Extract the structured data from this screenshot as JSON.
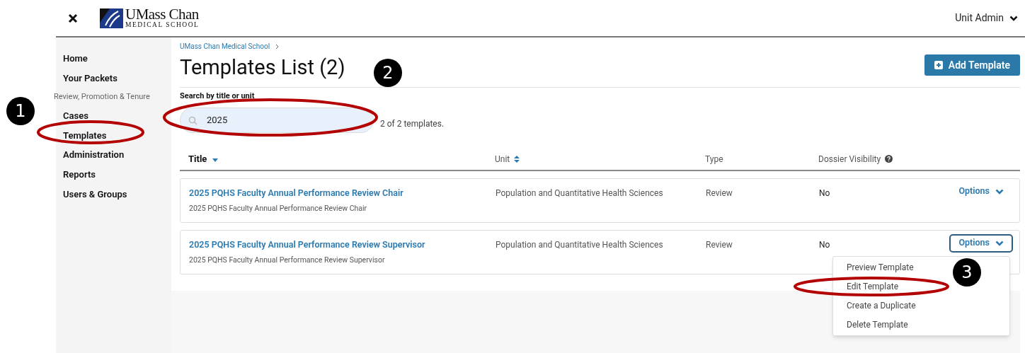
{
  "header": {
    "logo_top": "UMass Chan",
    "logo_bottom": "MEDICAL SCHOOL",
    "user_menu": "Unit Admin"
  },
  "sidebar": {
    "items": [
      {
        "label": "Home",
        "kind": "link"
      },
      {
        "label": "Your Packets",
        "kind": "link"
      },
      {
        "label": "Review, Promotion & Tenure",
        "kind": "section"
      },
      {
        "label": "Cases",
        "kind": "link"
      },
      {
        "label": "Templates",
        "kind": "link"
      },
      {
        "label": "Administration",
        "kind": "link"
      },
      {
        "label": "Reports",
        "kind": "link"
      },
      {
        "label": "Users & Groups",
        "kind": "link"
      }
    ]
  },
  "breadcrumb": [
    "UMass Chan Medical School"
  ],
  "page_title": "Templates List (2)",
  "add_button": "Add Template",
  "search": {
    "label": "Search by title or unit",
    "value": "2025",
    "result": "2 of 2 templates."
  },
  "table": {
    "columns": [
      {
        "label": "Title",
        "sorted": true
      },
      {
        "label": "Unit",
        "sorted": false
      },
      {
        "label": "Type"
      },
      {
        "label": "Dossier Visibility",
        "help": true
      }
    ],
    "rows": [
      {
        "title": "2025 PQHS Faculty Annual Performance Review Chair",
        "subtitle": "2025 PQHS Faculty Annual Performance Review Chair",
        "unit": "Population and Quantitative Health Sciences",
        "type": "Review",
        "visibility": "No",
        "options": "Options",
        "expanded": false
      },
      {
        "title": "2025 PQHS Faculty Annual Performance Review Supervisor",
        "subtitle": "2025 PQHS Faculty Annual Performance Review Supervisor",
        "unit": "Population and Quantitative Health Sciences",
        "type": "Review",
        "visibility": "No",
        "options": "Options",
        "expanded": true,
        "menu": [
          "Preview Template",
          "Edit Template",
          "Create a Duplicate",
          "Delete Template"
        ]
      }
    ]
  },
  "annotations": [
    {
      "label": "1"
    },
    {
      "label": "2"
    },
    {
      "label": "3"
    }
  ]
}
